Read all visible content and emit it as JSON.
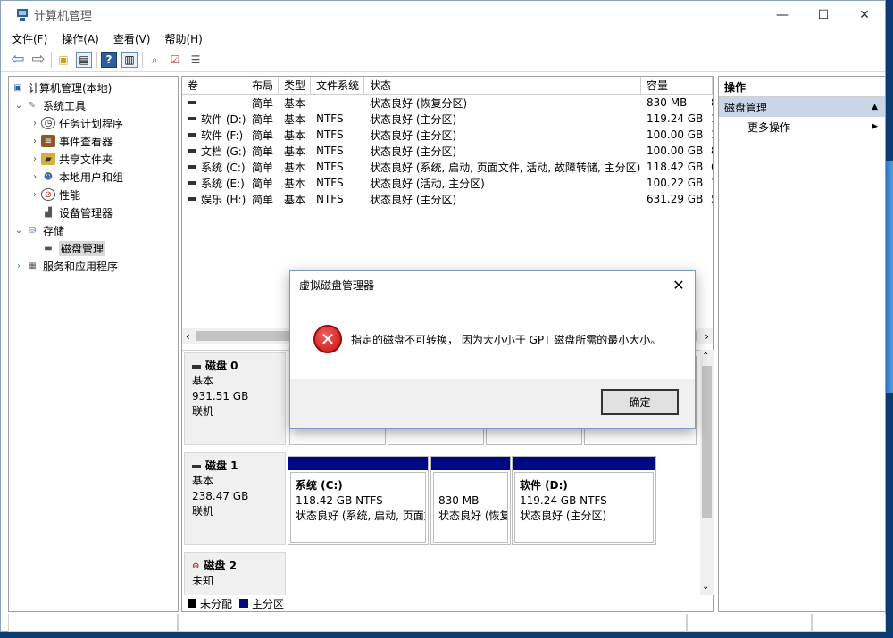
{
  "window": {
    "title": "计算机管理",
    "controls": [
      "—",
      "☐",
      "✕"
    ]
  },
  "menu": [
    "文件(F)",
    "操作(A)",
    "查看(V)",
    "帮助(H)"
  ],
  "tree": {
    "root": "计算机管理(本地)",
    "system_tools": "系统工具",
    "items": [
      "任务计划程序",
      "事件查看器",
      "共享文件夹",
      "本地用户和组",
      "性能",
      "设备管理器"
    ],
    "storage": "存储",
    "disk_mgmt": "磁盘管理",
    "services": "服务和应用程序"
  },
  "volume_table": {
    "headers": [
      "卷",
      "布局",
      "类型",
      "文件系统",
      "状态",
      "容量",
      ""
    ],
    "rows": [
      [
        "",
        "简单",
        "基本",
        "",
        "状态良好 (恢复分区)",
        "830 MB",
        "8"
      ],
      [
        "软件 (D:)",
        "简单",
        "基本",
        "NTFS",
        "状态良好 (主分区)",
        "119.24 GB",
        "1"
      ],
      [
        "软件 (F:)",
        "简单",
        "基本",
        "NTFS",
        "状态良好 (主分区)",
        "100.00 GB",
        "1"
      ],
      [
        "文档 (G:)",
        "简单",
        "基本",
        "NTFS",
        "状态良好 (主分区)",
        "100.00 GB",
        "8"
      ],
      [
        "系统 (C:)",
        "简单",
        "基本",
        "NTFS",
        "状态良好 (系统, 启动, 页面文件, 活动, 故障转储, 主分区)",
        "118.42 GB",
        "6"
      ],
      [
        "系统 (E:)",
        "简单",
        "基本",
        "NTFS",
        "状态良好 (活动, 主分区)",
        "100.22 GB",
        "1"
      ],
      [
        "娱乐 (H:)",
        "简单",
        "基本",
        "NTFS",
        "状态良好 (主分区)",
        "631.29 GB",
        "5"
      ]
    ]
  },
  "disks": [
    {
      "name": "磁盘 0",
      "type": "基本",
      "size": "931.51 GB",
      "status": "联机"
    },
    {
      "name": "磁盘 1",
      "type": "基本",
      "size": "238.47 GB",
      "status": "联机",
      "partitions": [
        {
          "title": "系统 (C:)",
          "size": "118.42 GB NTFS",
          "status": "状态良好 (系统, 启动, 页面文"
        },
        {
          "title": "",
          "size": "830 MB",
          "status": "状态良好 (恢复"
        },
        {
          "title": "软件 (D:)",
          "size": "119.24 GB NTFS",
          "status": "状态良好 (主分区)"
        }
      ]
    },
    {
      "name": "磁盘 2",
      "type": "未知",
      "size": "",
      "status": ""
    }
  ],
  "legend": [
    {
      "label": "未分配",
      "color": "#000000"
    },
    {
      "label": "主分区",
      "color": "#000a80"
    }
  ],
  "actions": {
    "header": "操作",
    "section": "磁盘管理",
    "more": "更多操作"
  },
  "dialog": {
    "title": "虚拟磁盘管理器",
    "message": "指定的磁盘不可转换， 因为大小小于 GPT 磁盘所需的最小大小。",
    "ok": "确定",
    "icon": "error-icon"
  }
}
